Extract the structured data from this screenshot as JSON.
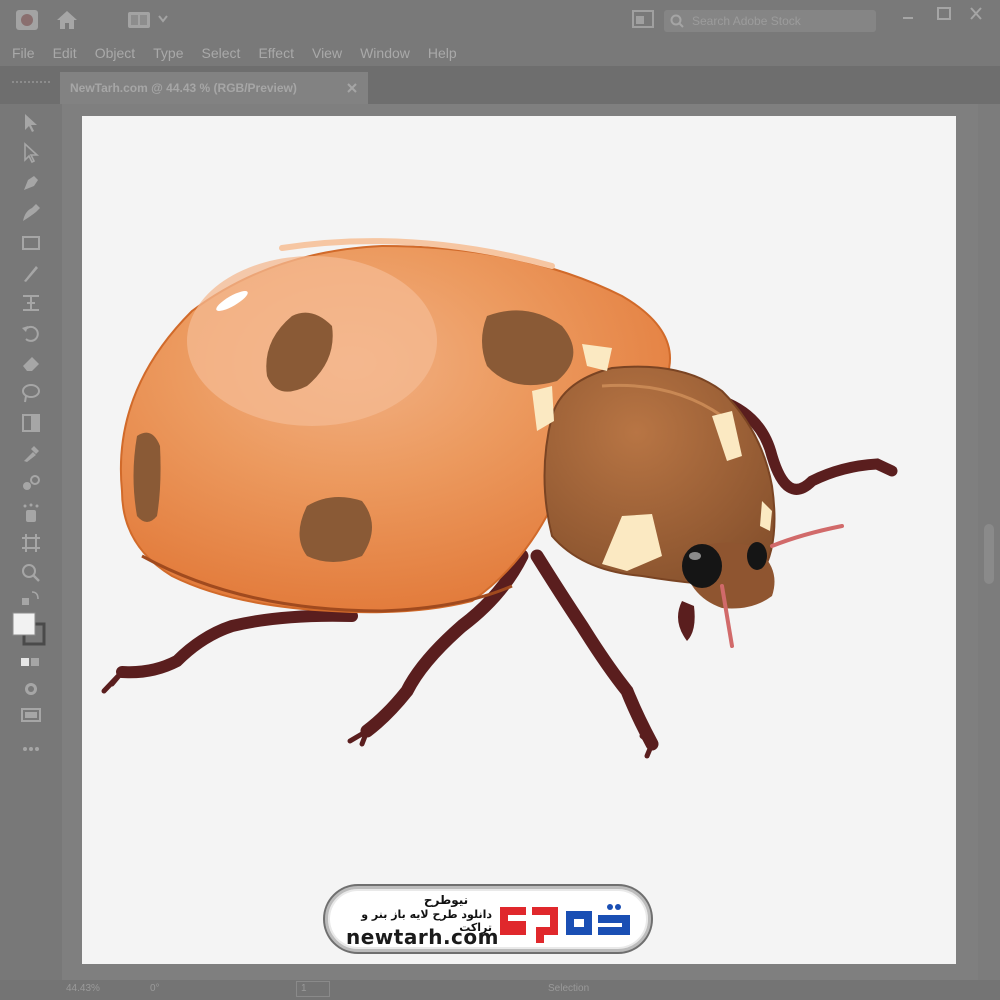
{
  "app": {
    "search_placeholder": "Search Adobe Stock",
    "menu": [
      "File",
      "Edit",
      "Object",
      "Type",
      "Select",
      "Effect",
      "View",
      "Window",
      "Help"
    ]
  },
  "document": {
    "tab_label": "NewTarh.com @ 44.43 % (RGB/Preview)",
    "tab_close": "×"
  },
  "status": {
    "zoom": "44.43%",
    "rotation": "0°",
    "page": "1",
    "tool": "Selection"
  },
  "watermark": {
    "brand_fa": "نیوطرح",
    "slogan_fa": "دانلود طرح لایه باز بنر و تراکت",
    "site": "newtarh.com",
    "logo_text": "نیوطرح"
  },
  "colors": {
    "ui_background": "#7b7b7b",
    "artboard": "#f4f4f4",
    "shell_orange": "#e7894a",
    "spot_brown": "#8a5a36",
    "head_brown": "#9c6035",
    "leg_maroon": "#5a1e1e",
    "logo_red": "#e0282c"
  },
  "icons": {
    "home": "home-icon",
    "workspace": "grid-icon",
    "search": "search-icon",
    "toolbar": [
      "selection-arrow-icon",
      "direct-selection-icon",
      "pen-icon",
      "curvature-icon",
      "rectangle-icon",
      "brush-icon",
      "width-icon",
      "rotate-icon",
      "eraser-icon",
      "lasso-icon",
      "gradient-icon",
      "eyedropper-icon",
      "blend-icon",
      "symbol-sprayer-icon",
      "artboard-icon",
      "zoom-icon",
      "swap-colors-icon",
      "fill-stroke-icon",
      "color-mode-icon",
      "draw-mode-icon",
      "screen-mode-icon",
      "more-tools-icon"
    ]
  }
}
